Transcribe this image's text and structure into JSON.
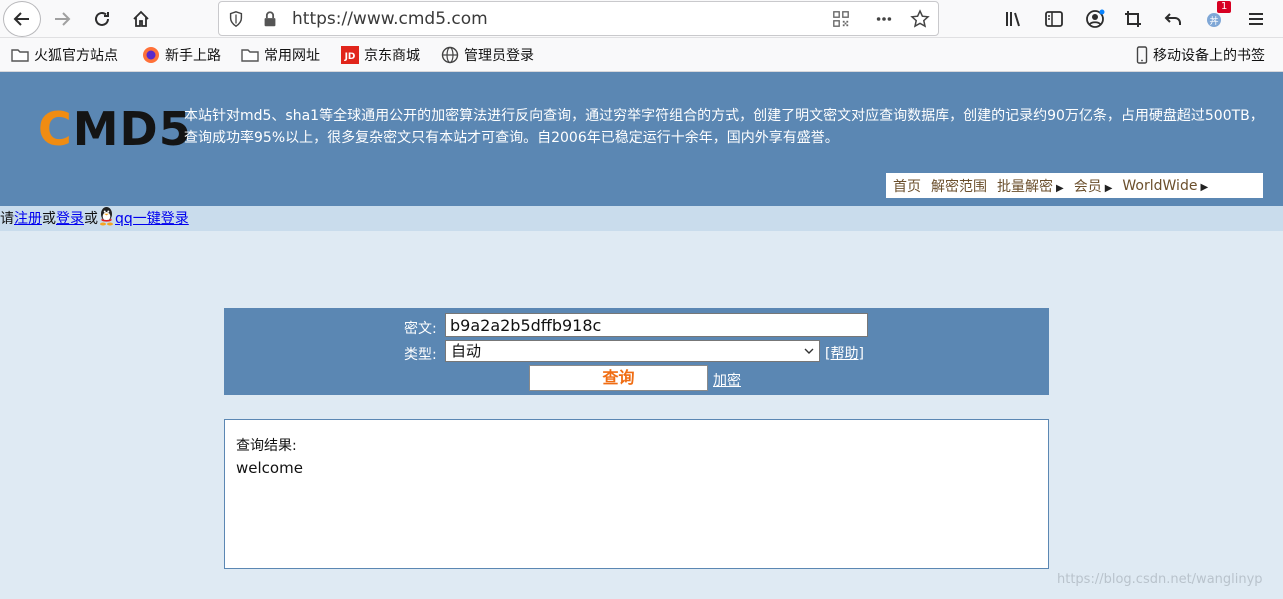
{
  "browser": {
    "url": "https://www.cmd5.com",
    "notification_count": "1",
    "bookmarks": [
      {
        "label": "火狐官方站点",
        "icon": "folder-icon"
      },
      {
        "label": "新手上路",
        "icon": "firefox-icon"
      },
      {
        "label": "常用网址",
        "icon": "folder-icon"
      },
      {
        "label": "京东商城",
        "icon": "jd-icon"
      },
      {
        "label": "管理员登录",
        "icon": "globe-icon"
      }
    ],
    "mobile_bookmarks": "移动设备上的书签"
  },
  "site": {
    "logo_c": "C",
    "logo_rest": "MD5",
    "intro": "本站针对md5、sha1等全球通用公开的加密算法进行反向查询，通过穷举字符组合的方式，创建了明文密文对应查询数据库，创建的记录约90万亿条，占用硬盘超过500TB，查询成功率95%以上，很多复杂密文只有本站才可查询。自2006年已稳定运行十余年，国内外享有盛誉。",
    "nav": {
      "home": "首页",
      "decrypt_range": "解密范围",
      "batch_decrypt": "批量解密",
      "member": "会员",
      "worldwide": "WorldWide"
    }
  },
  "login": {
    "please": "请",
    "register": "注册",
    "or1": "或",
    "login": "登录",
    "or2": "或",
    "qq_login": "qq一键登录"
  },
  "query": {
    "cipher_label": "密文:",
    "cipher_value": "b9a2a2b5dffb918c",
    "type_label": "类型:",
    "type_value": "自动",
    "help": "[帮助]",
    "submit": "查询",
    "encrypt": "加密"
  },
  "result": {
    "label": "查询结果:",
    "value": "welcome"
  },
  "watermark": "https://blog.csdn.net/wanglinyp"
}
